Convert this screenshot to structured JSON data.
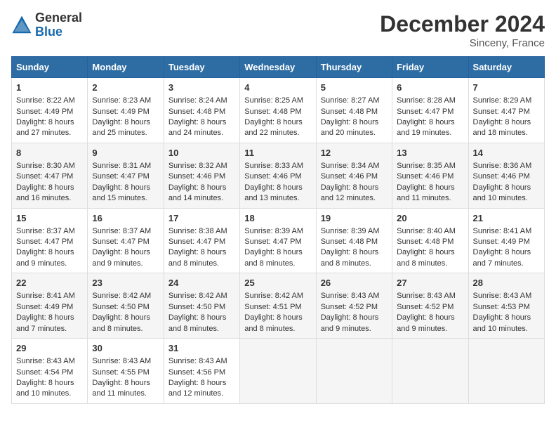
{
  "header": {
    "logo_general": "General",
    "logo_blue": "Blue",
    "month": "December 2024",
    "location": "Sinceny, France"
  },
  "calendar": {
    "weekdays": [
      "Sunday",
      "Monday",
      "Tuesday",
      "Wednesday",
      "Thursday",
      "Friday",
      "Saturday"
    ],
    "weeks": [
      [
        {
          "day": "1",
          "lines": [
            "Sunrise: 8:22 AM",
            "Sunset: 4:49 PM",
            "Daylight: 8 hours",
            "and 27 minutes."
          ]
        },
        {
          "day": "2",
          "lines": [
            "Sunrise: 8:23 AM",
            "Sunset: 4:49 PM",
            "Daylight: 8 hours",
            "and 25 minutes."
          ]
        },
        {
          "day": "3",
          "lines": [
            "Sunrise: 8:24 AM",
            "Sunset: 4:48 PM",
            "Daylight: 8 hours",
            "and 24 minutes."
          ]
        },
        {
          "day": "4",
          "lines": [
            "Sunrise: 8:25 AM",
            "Sunset: 4:48 PM",
            "Daylight: 8 hours",
            "and 22 minutes."
          ]
        },
        {
          "day": "5",
          "lines": [
            "Sunrise: 8:27 AM",
            "Sunset: 4:48 PM",
            "Daylight: 8 hours",
            "and 20 minutes."
          ]
        },
        {
          "day": "6",
          "lines": [
            "Sunrise: 8:28 AM",
            "Sunset: 4:47 PM",
            "Daylight: 8 hours",
            "and 19 minutes."
          ]
        },
        {
          "day": "7",
          "lines": [
            "Sunrise: 8:29 AM",
            "Sunset: 4:47 PM",
            "Daylight: 8 hours",
            "and 18 minutes."
          ]
        }
      ],
      [
        {
          "day": "8",
          "lines": [
            "Sunrise: 8:30 AM",
            "Sunset: 4:47 PM",
            "Daylight: 8 hours",
            "and 16 minutes."
          ]
        },
        {
          "day": "9",
          "lines": [
            "Sunrise: 8:31 AM",
            "Sunset: 4:47 PM",
            "Daylight: 8 hours",
            "and 15 minutes."
          ]
        },
        {
          "day": "10",
          "lines": [
            "Sunrise: 8:32 AM",
            "Sunset: 4:46 PM",
            "Daylight: 8 hours",
            "and 14 minutes."
          ]
        },
        {
          "day": "11",
          "lines": [
            "Sunrise: 8:33 AM",
            "Sunset: 4:46 PM",
            "Daylight: 8 hours",
            "and 13 minutes."
          ]
        },
        {
          "day": "12",
          "lines": [
            "Sunrise: 8:34 AM",
            "Sunset: 4:46 PM",
            "Daylight: 8 hours",
            "and 12 minutes."
          ]
        },
        {
          "day": "13",
          "lines": [
            "Sunrise: 8:35 AM",
            "Sunset: 4:46 PM",
            "Daylight: 8 hours",
            "and 11 minutes."
          ]
        },
        {
          "day": "14",
          "lines": [
            "Sunrise: 8:36 AM",
            "Sunset: 4:46 PM",
            "Daylight: 8 hours",
            "and 10 minutes."
          ]
        }
      ],
      [
        {
          "day": "15",
          "lines": [
            "Sunrise: 8:37 AM",
            "Sunset: 4:47 PM",
            "Daylight: 8 hours",
            "and 9 minutes."
          ]
        },
        {
          "day": "16",
          "lines": [
            "Sunrise: 8:37 AM",
            "Sunset: 4:47 PM",
            "Daylight: 8 hours",
            "and 9 minutes."
          ]
        },
        {
          "day": "17",
          "lines": [
            "Sunrise: 8:38 AM",
            "Sunset: 4:47 PM",
            "Daylight: 8 hours",
            "and 8 minutes."
          ]
        },
        {
          "day": "18",
          "lines": [
            "Sunrise: 8:39 AM",
            "Sunset: 4:47 PM",
            "Daylight: 8 hours",
            "and 8 minutes."
          ]
        },
        {
          "day": "19",
          "lines": [
            "Sunrise: 8:39 AM",
            "Sunset: 4:48 PM",
            "Daylight: 8 hours",
            "and 8 minutes."
          ]
        },
        {
          "day": "20",
          "lines": [
            "Sunrise: 8:40 AM",
            "Sunset: 4:48 PM",
            "Daylight: 8 hours",
            "and 8 minutes."
          ]
        },
        {
          "day": "21",
          "lines": [
            "Sunrise: 8:41 AM",
            "Sunset: 4:49 PM",
            "Daylight: 8 hours",
            "and 7 minutes."
          ]
        }
      ],
      [
        {
          "day": "22",
          "lines": [
            "Sunrise: 8:41 AM",
            "Sunset: 4:49 PM",
            "Daylight: 8 hours",
            "and 7 minutes."
          ]
        },
        {
          "day": "23",
          "lines": [
            "Sunrise: 8:42 AM",
            "Sunset: 4:50 PM",
            "Daylight: 8 hours",
            "and 8 minutes."
          ]
        },
        {
          "day": "24",
          "lines": [
            "Sunrise: 8:42 AM",
            "Sunset: 4:50 PM",
            "Daylight: 8 hours",
            "and 8 minutes."
          ]
        },
        {
          "day": "25",
          "lines": [
            "Sunrise: 8:42 AM",
            "Sunset: 4:51 PM",
            "Daylight: 8 hours",
            "and 8 minutes."
          ]
        },
        {
          "day": "26",
          "lines": [
            "Sunrise: 8:43 AM",
            "Sunset: 4:52 PM",
            "Daylight: 8 hours",
            "and 9 minutes."
          ]
        },
        {
          "day": "27",
          "lines": [
            "Sunrise: 8:43 AM",
            "Sunset: 4:52 PM",
            "Daylight: 8 hours",
            "and 9 minutes."
          ]
        },
        {
          "day": "28",
          "lines": [
            "Sunrise: 8:43 AM",
            "Sunset: 4:53 PM",
            "Daylight: 8 hours",
            "and 10 minutes."
          ]
        }
      ],
      [
        {
          "day": "29",
          "lines": [
            "Sunrise: 8:43 AM",
            "Sunset: 4:54 PM",
            "Daylight: 8 hours",
            "and 10 minutes."
          ]
        },
        {
          "day": "30",
          "lines": [
            "Sunrise: 8:43 AM",
            "Sunset: 4:55 PM",
            "Daylight: 8 hours",
            "and 11 minutes."
          ]
        },
        {
          "day": "31",
          "lines": [
            "Sunrise: 8:43 AM",
            "Sunset: 4:56 PM",
            "Daylight: 8 hours",
            "and 12 minutes."
          ]
        },
        {
          "day": "",
          "lines": []
        },
        {
          "day": "",
          "lines": []
        },
        {
          "day": "",
          "lines": []
        },
        {
          "day": "",
          "lines": []
        }
      ]
    ]
  }
}
